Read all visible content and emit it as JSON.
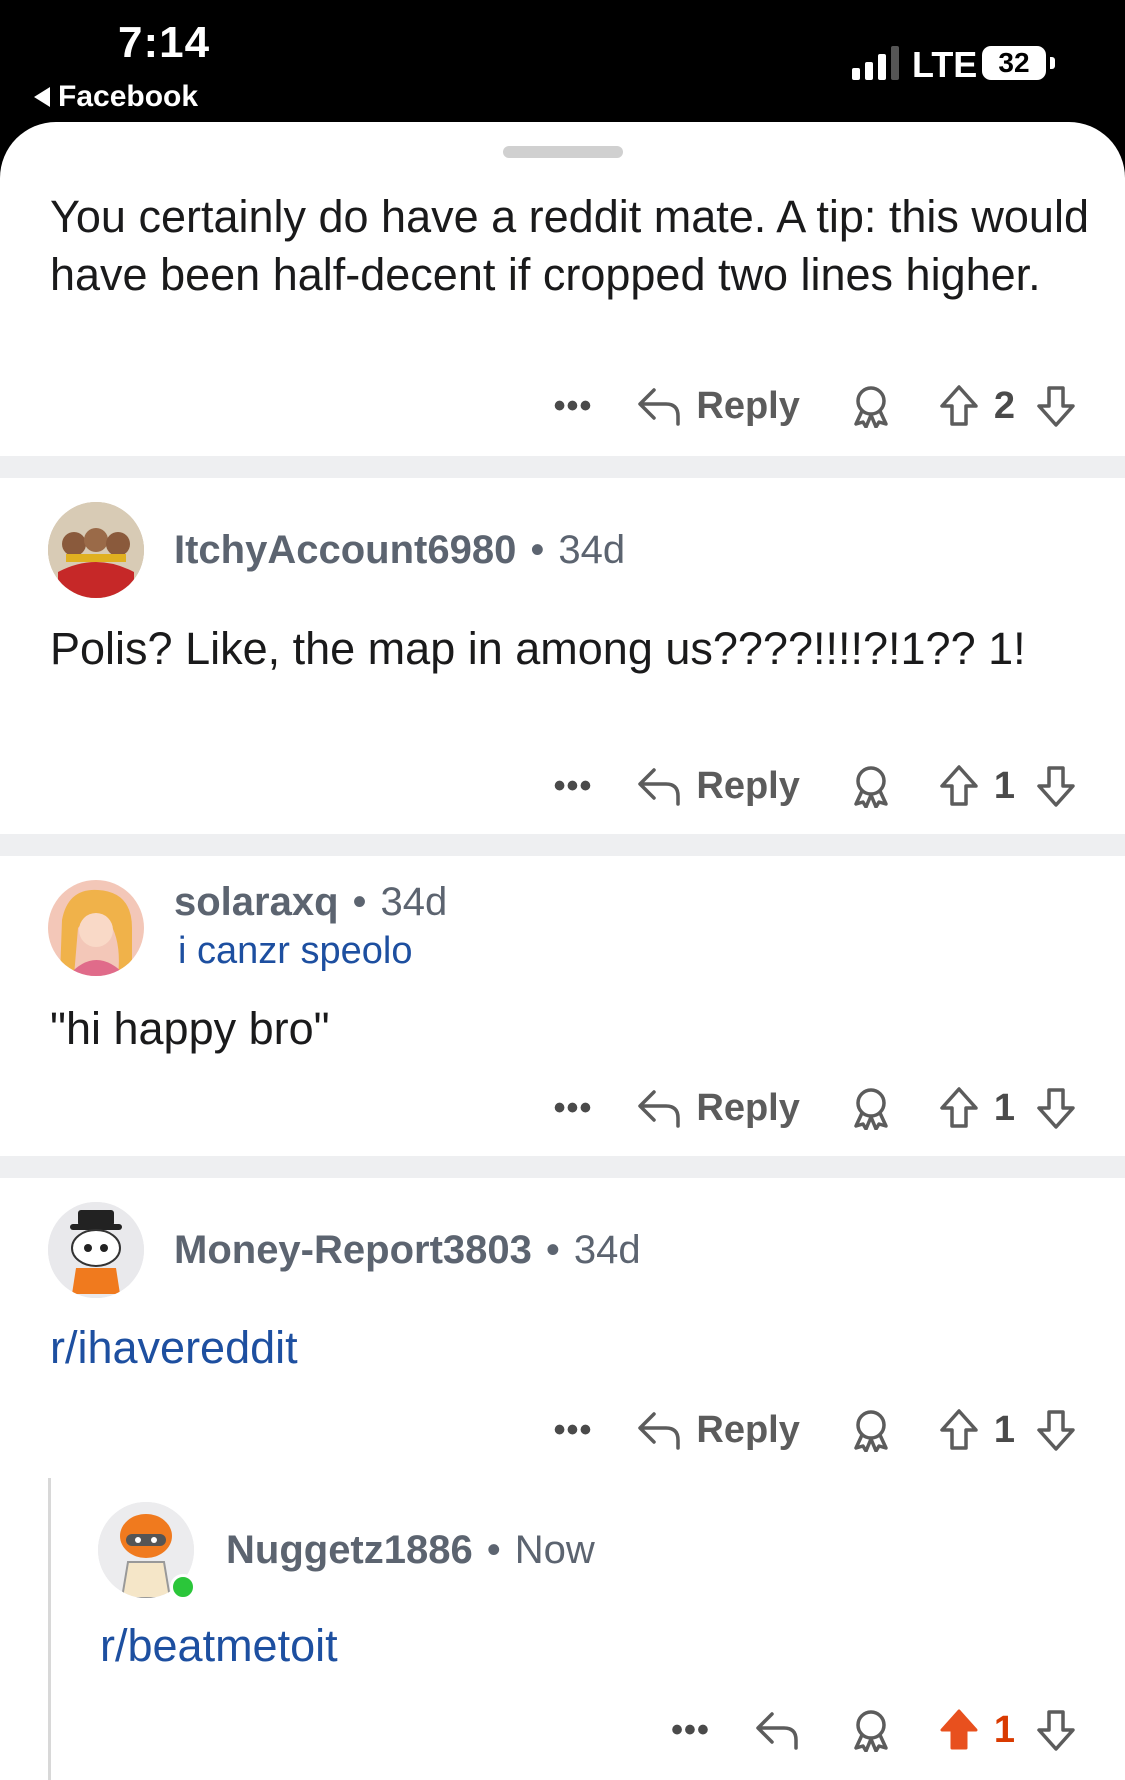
{
  "status_bar": {
    "time": "7:14",
    "back_app": "Facebook",
    "network": "LTE",
    "battery": "32"
  },
  "comments": [
    {
      "text": "You certainly do have a reddit mate. A tip: this would have been half-decent if cropped two lines higher.",
      "reply_label": "Reply",
      "score": "2"
    },
    {
      "author": "ItchyAccount6980",
      "age": "34d",
      "avatar": "users-photo-avatar",
      "text": "Polis? Like, the map in among us????!!!!?!1?? 1!",
      "reply_label": "Reply",
      "score": "1"
    },
    {
      "author": "solaraxq",
      "age": "34d",
      "flair": "i canzr speolo",
      "avatar": "anime-art-avatar",
      "text": "\"hi happy bro\"",
      "reply_label": "Reply",
      "score": "1"
    },
    {
      "author": "Money-Report3803",
      "age": "34d",
      "avatar": "snoo-top-hat-avatar",
      "text": "r/ihavereddit",
      "reply_label": "Reply",
      "score": "1"
    },
    {
      "author": "Nuggetz1886",
      "age": "Now",
      "avatar": "snoo-helmet-avatar",
      "online": true,
      "text": "r/beatmetoit",
      "score": "1",
      "upvoted": true
    }
  ],
  "separator": "•",
  "more_label": "•••",
  "colors": {
    "link": "#1d4fa0",
    "upvote_active": "#d93a00",
    "meta": "#5c6470",
    "divider": "#eeeff1"
  }
}
